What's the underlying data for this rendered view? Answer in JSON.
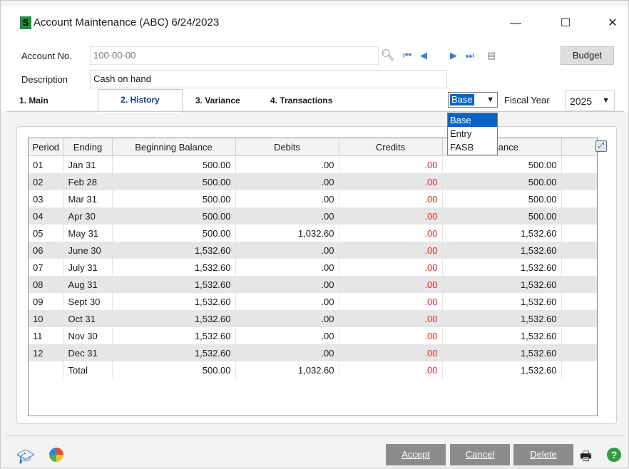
{
  "window": {
    "title": "Account Maintenance (ABC) 6/24/2023",
    "app_icon": "S"
  },
  "titlebar": {
    "minimize": "—",
    "maximize": "☐",
    "close": "✕"
  },
  "form": {
    "account_no_label": "Account No.",
    "account_no_value": "100-00-00",
    "description_label": "Description",
    "description_value": "Cash on hand",
    "budget_button": "Budget"
  },
  "tabs": [
    {
      "label": "1. Main"
    },
    {
      "label": "2. History"
    },
    {
      "label": "3. Variance"
    },
    {
      "label": "4. Transactions"
    }
  ],
  "basis": {
    "selected": "Base",
    "options": [
      "Base",
      "Entry",
      "FASB"
    ]
  },
  "fiscal_year": {
    "label": "Fiscal Year",
    "value": "2025"
  },
  "grid": {
    "columns": [
      "Period",
      "Ending",
      "Beginning Balance",
      "Debits",
      "Credits",
      "Balance"
    ],
    "rows": [
      [
        "01",
        "Jan 31",
        "500.00",
        ".00",
        ".00",
        "500.00"
      ],
      [
        "02",
        "Feb 28",
        "500.00",
        ".00",
        ".00",
        "500.00"
      ],
      [
        "03",
        "Mar 31",
        "500.00",
        ".00",
        ".00",
        "500.00"
      ],
      [
        "04",
        "Apr 30",
        "500.00",
        ".00",
        ".00",
        "500.00"
      ],
      [
        "05",
        "May 31",
        "500.00",
        "1,032.60",
        ".00",
        "1,532.60"
      ],
      [
        "06",
        "June 30",
        "1,532.60",
        ".00",
        ".00",
        "1,532.60"
      ],
      [
        "07",
        "July 31",
        "1,532.60",
        ".00",
        ".00",
        "1,532.60"
      ],
      [
        "08",
        "Aug 31",
        "1,532.60",
        ".00",
        ".00",
        "1,532.60"
      ],
      [
        "09",
        "Sept 30",
        "1,532.60",
        ".00",
        ".00",
        "1,532.60"
      ],
      [
        "10",
        "Oct 31",
        "1,532.60",
        ".00",
        ".00",
        "1,532.60"
      ],
      [
        "11",
        "Nov 30",
        "1,532.60",
        ".00",
        ".00",
        "1,532.60"
      ],
      [
        "12",
        "Dec 31",
        "1,532.60",
        ".00",
        ".00",
        "1,532.60"
      ],
      [
        "",
        "Total",
        "500.00",
        "1,032.60",
        ".00",
        "1,532.60"
      ]
    ]
  },
  "footer": {
    "accept": "Accept",
    "cancel": "Cancel",
    "delete": "Delete"
  },
  "colors": {
    "credit_text": "#e8261e",
    "selection": "#0a64c8",
    "button_gray": "#8c8c8c"
  }
}
